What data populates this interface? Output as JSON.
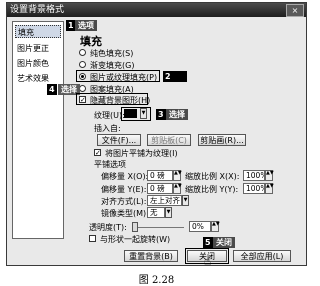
{
  "dialog": {
    "title": "设置背景格式",
    "close_glyph": "×"
  },
  "sidebar": {
    "items": [
      {
        "label": "填充"
      },
      {
        "label": "图片更正"
      },
      {
        "label": "图片颜色"
      },
      {
        "label": "艺术效果"
      }
    ]
  },
  "markers": {
    "m1": "1",
    "m1b": "选项",
    "m2": "2",
    "m3": "3",
    "m3b": "选择",
    "m4": "4",
    "m4b": "选择",
    "m5": "5",
    "m5b": "关闭"
  },
  "fill": {
    "section_title": "填充",
    "options": [
      {
        "label": "纯色填充(S)",
        "checked": false
      },
      {
        "label": "渐变填充(G)",
        "checked": false
      },
      {
        "label": "图片或纹理填充(P)",
        "checked": true
      },
      {
        "label": "图案填充(A)",
        "checked": false
      }
    ],
    "hide_background": {
      "label": "隐藏背景图形(H)",
      "checked": true
    },
    "texture_label": "纹理(U):",
    "insert_from_label": "插入自:",
    "buttons": {
      "file": "文件(F)...",
      "clipboard": "剪贴板(C)",
      "clip_art": "剪贴画(R)..."
    },
    "tile_label": "将图片平铺为纹理(I)",
    "tile_checked": true,
    "tile_options_label": "平铺选项",
    "offset_x_label": "偏移量 X(O):",
    "offset_x_value": "0 磅",
    "offset_y_label": "偏移量 Y(E):",
    "offset_y_value": "0 磅",
    "scale_x_label": "缩放比例 X(X):",
    "scale_x_value": "100%",
    "scale_y_label": "缩放比例 Y(Y):",
    "scale_y_value": "100%",
    "align_label": "对齐方式(L):",
    "align_value": "左上对齐",
    "mirror_label": "镜像类型(M):",
    "mirror_value": "无",
    "transparency_label": "透明度(T):",
    "transparency_value": "0%",
    "transparency_level": 0,
    "rotate_label": "与形状一起旋转(W)",
    "rotate_checked": false
  },
  "footer": {
    "reset": "重置背景(B)",
    "close": "关闭",
    "apply_all": "全部应用(L)"
  },
  "caption": "图 2.28"
}
